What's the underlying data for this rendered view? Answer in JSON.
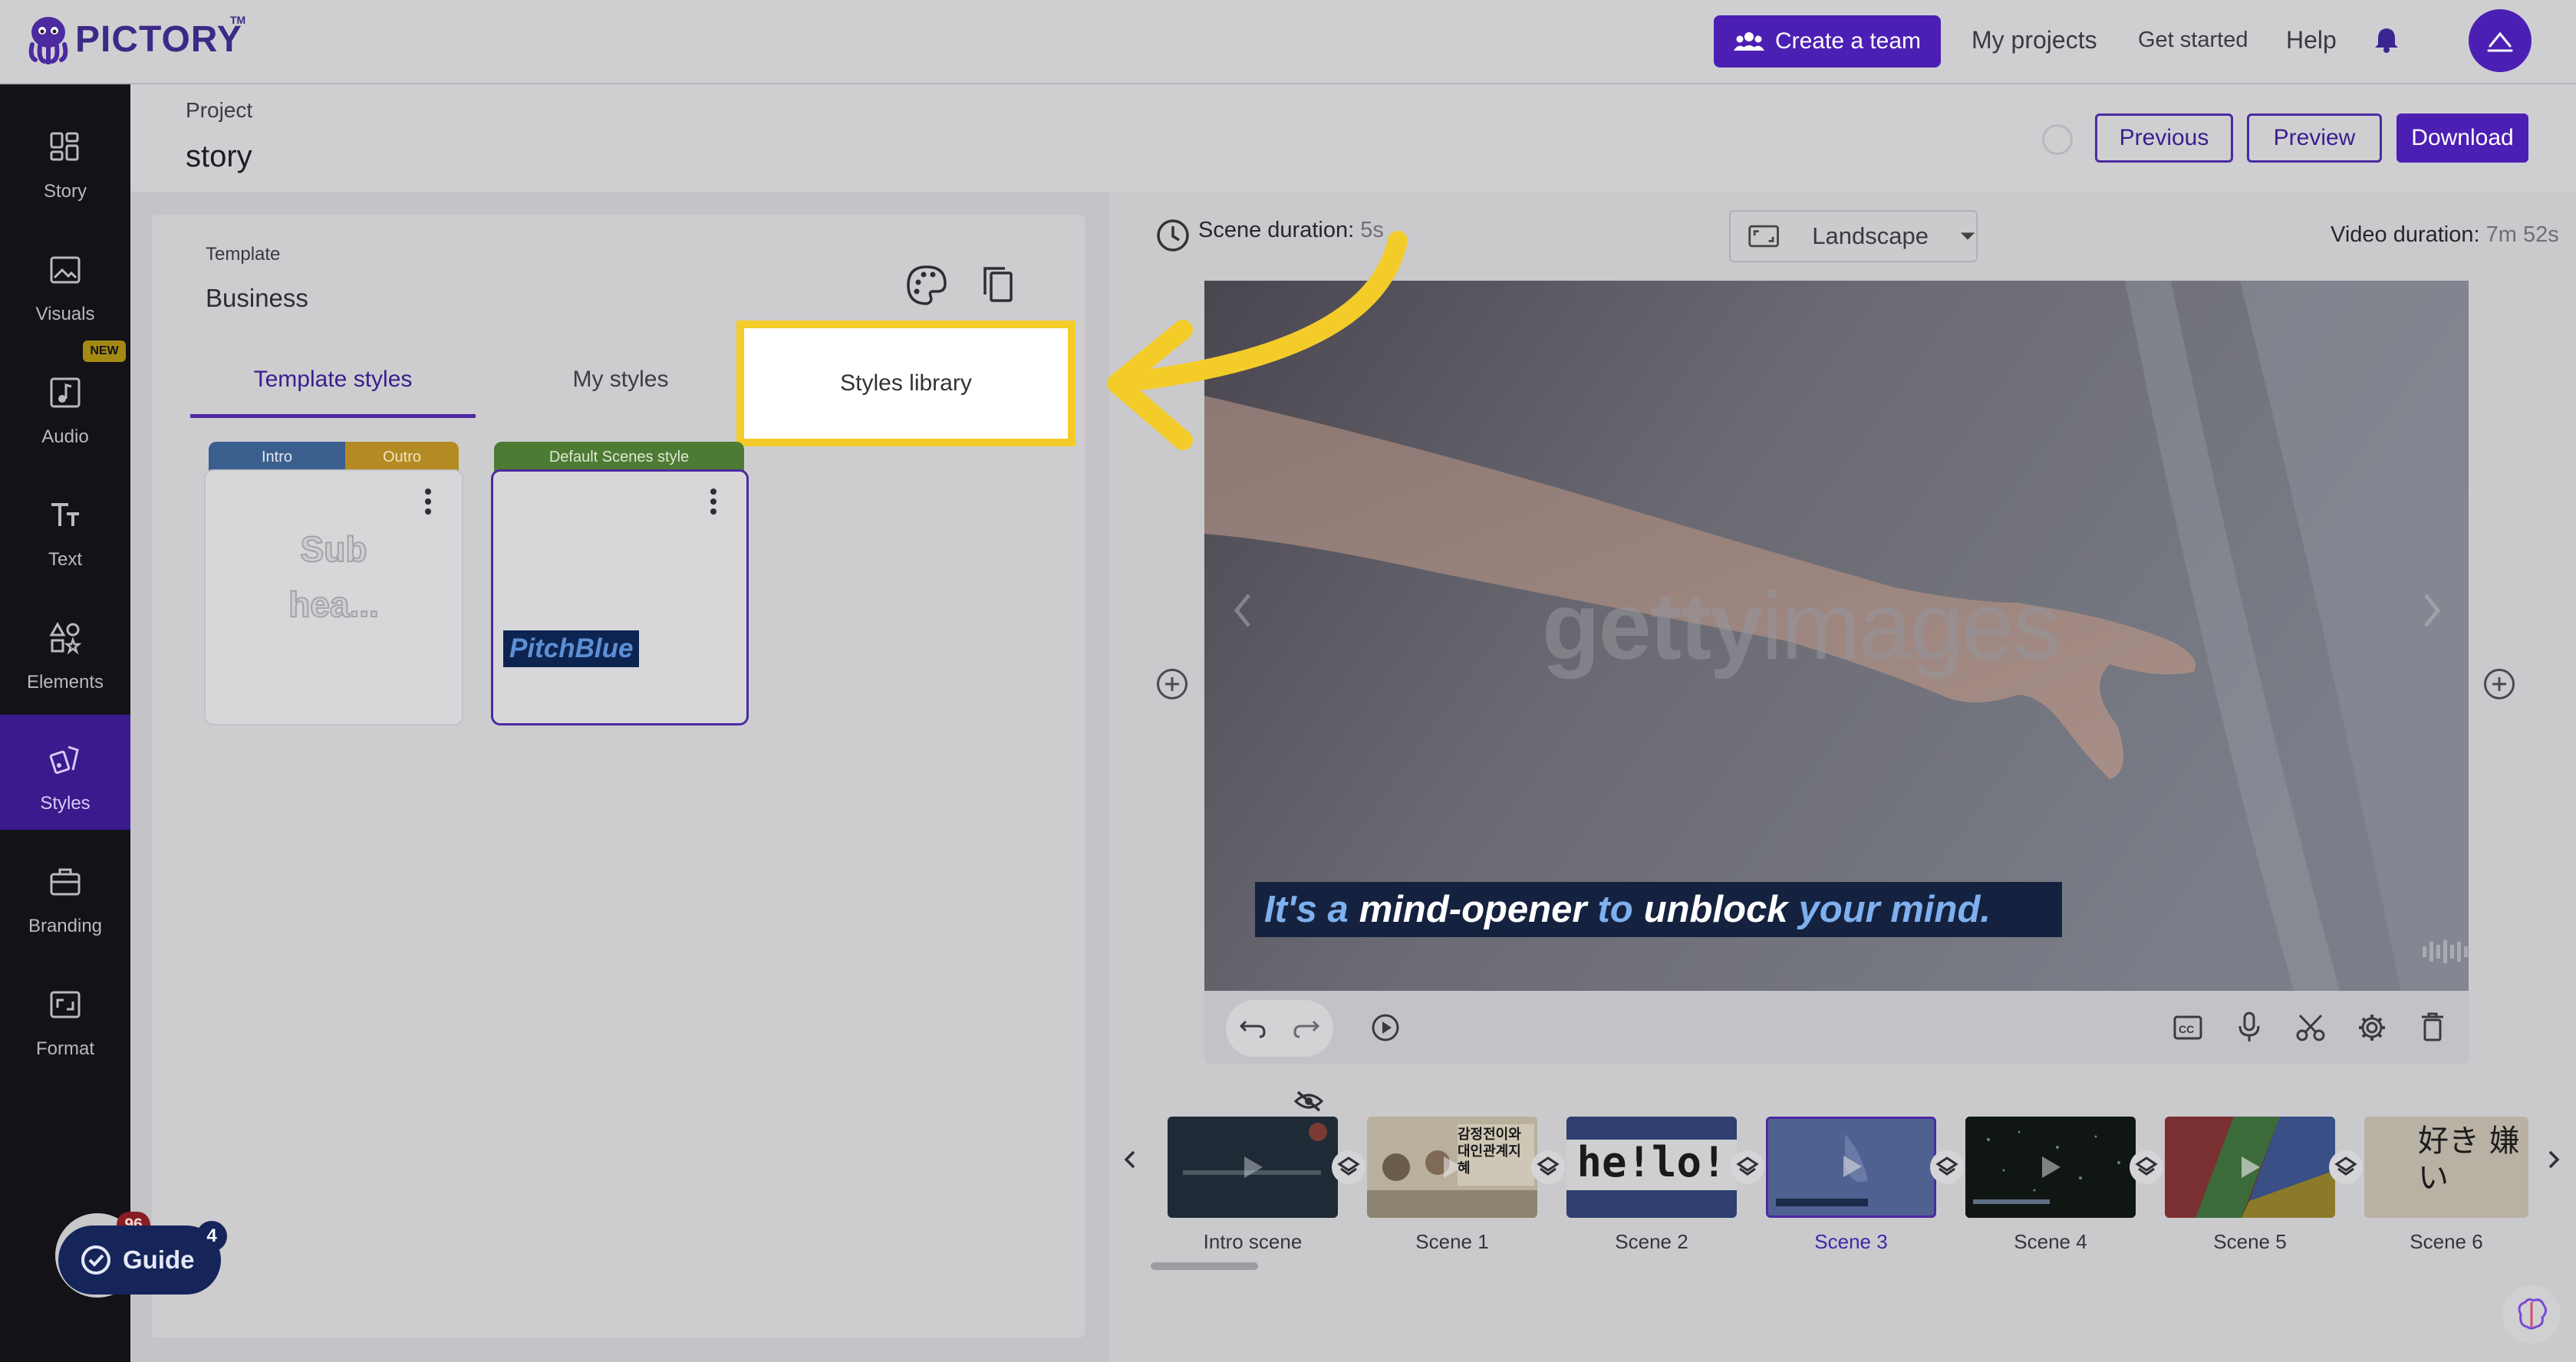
{
  "topbar": {
    "logo": "PICTORY",
    "logo_tm": "TM",
    "create_team": "Create a team",
    "my_projects": "My projects",
    "get_started": "Get started",
    "help": "Help"
  },
  "sidebar": {
    "items": [
      {
        "label": "Story",
        "icon": "story-grid-icon"
      },
      {
        "label": "Visuals",
        "icon": "image-icon"
      },
      {
        "label": "Audio",
        "icon": "music-note-icon",
        "badge": "NEW"
      },
      {
        "label": "Text",
        "icon": "text-icon"
      },
      {
        "label": "Elements",
        "icon": "shapes-icon"
      },
      {
        "label": "Styles",
        "icon": "styles-icon",
        "active": true
      },
      {
        "label": "Branding",
        "icon": "briefcase-icon"
      },
      {
        "label": "Format",
        "icon": "format-icon"
      }
    ]
  },
  "project": {
    "label": "Project",
    "name": "story",
    "previous": "Previous",
    "preview": "Preview",
    "download": "Download"
  },
  "style_panel": {
    "template_label": "Template",
    "template_name": "Business",
    "tabs": [
      "Template styles",
      "My styles",
      "Styles library"
    ],
    "active_tab": "Template styles",
    "highlighted_tab": "Styles library",
    "cards": [
      {
        "tag_left": "Intro",
        "tag_right": "Outro",
        "preview_line1": "Sub",
        "preview_line2": "hea..."
      },
      {
        "tag": "Default Scenes style",
        "preview": "PitchBlue"
      }
    ]
  },
  "editor": {
    "scene_duration_label": "Scene duration:",
    "scene_duration_value": "5s",
    "orientation": "Landscape",
    "video_duration_label": "Video duration:",
    "video_duration_value": "7m 52s",
    "watermark_left": "getty",
    "watermark_right": "images",
    "caption_words": [
      {
        "text": "It's a",
        "color": "#7fb0ee"
      },
      {
        "text": "mind-opener",
        "color": "#ffffff"
      },
      {
        "text": "to",
        "color": "#7fb0ee"
      },
      {
        "text": "unblock",
        "color": "#ffffff"
      },
      {
        "text": "your mind.",
        "color": "#7fb0ee"
      }
    ]
  },
  "timeline": {
    "scenes": [
      {
        "label": "Intro scene",
        "thumb_text": ""
      },
      {
        "label": "Scene 1",
        "thumb_text": "감정전이와 대인관계지혜"
      },
      {
        "label": "Scene 2",
        "thumb_text": "he!lo!"
      },
      {
        "label": "Scene 3",
        "thumb_text": "",
        "active": true
      },
      {
        "label": "Scene 4",
        "thumb_text": ""
      },
      {
        "label": "Scene 5",
        "thumb_text": ""
      },
      {
        "label": "Scene 6",
        "thumb_text": "好き 嫌い"
      }
    ]
  },
  "guide": {
    "label": "Guide",
    "count": "4",
    "avatar_count": "96"
  },
  "colors": {
    "brand_purple": "#4c1fb4",
    "highlight_yellow": "#f3cc2a",
    "sidebar_bg": "#121217"
  }
}
